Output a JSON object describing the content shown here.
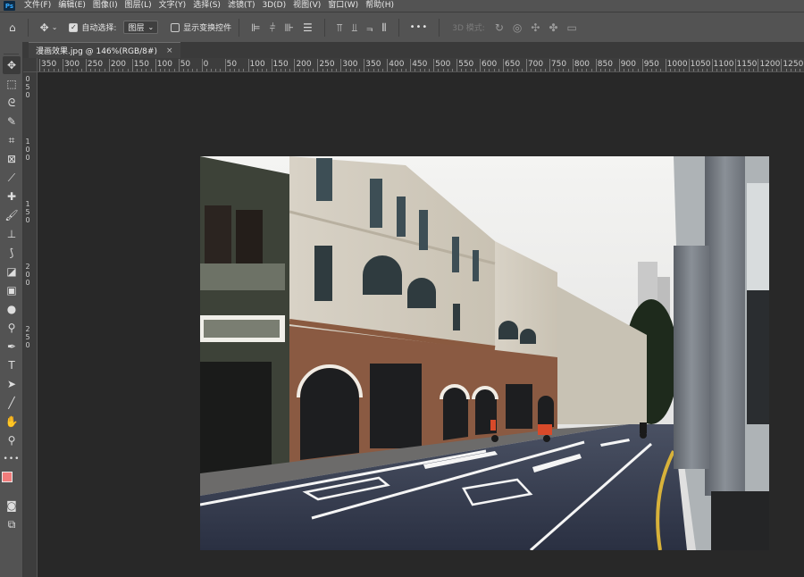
{
  "app": {
    "logo": "Ps"
  },
  "menu": [
    "文件(F)",
    "编辑(E)",
    "图像(I)",
    "图层(L)",
    "文字(Y)",
    "选择(S)",
    "滤镜(T)",
    "3D(D)",
    "视图(V)",
    "窗口(W)",
    "帮助(H)"
  ],
  "options": {
    "auto_select_label": "自动选择:",
    "auto_select_checked": true,
    "layer_select_value": "图层",
    "show_transform_label": "显示变换控件",
    "more_label": "•••",
    "mode_3d_label": "3D 模式:"
  },
  "document": {
    "tab_title": "漫画效果.jpg @ 146%(RGB/8#)",
    "close_glyph": "×"
  },
  "ruler": {
    "h_labels": [
      "350",
      "300",
      "250",
      "200",
      "150",
      "100",
      "50",
      "0",
      "50",
      "100",
      "150",
      "200",
      "250",
      "300",
      "350",
      "400",
      "450",
      "500",
      "550",
      "600",
      "650",
      "700",
      "750",
      "800",
      "850",
      "900",
      "950",
      "1000",
      "1050",
      "1100",
      "1150",
      "1200",
      "1250"
    ],
    "v_labels": [
      "0",
      "5",
      "0",
      "1",
      "0",
      "0",
      "1",
      "5",
      "0",
      "2",
      "0",
      "0",
      "2",
      "5",
      "0"
    ]
  },
  "tools": [
    "move-icon",
    "marquee-icon",
    "lasso-icon",
    "quick-select-icon",
    "crop-icon",
    "frame-icon",
    "eyedropper-icon",
    "healing-icon",
    "brush-icon",
    "stamp-icon",
    "history-brush-icon",
    "eraser-icon",
    "gradient-icon",
    "blur-icon",
    "dodge-icon",
    "pen-icon",
    "type-icon",
    "path-select-icon",
    "line-icon",
    "hand-icon",
    "zoom-icon",
    "more-tools-icon"
  ],
  "colors": {
    "foreground": "#f17c7b",
    "background": "#2b6bf0",
    "ui_panel": "#535353",
    "workspace": "#282828"
  }
}
